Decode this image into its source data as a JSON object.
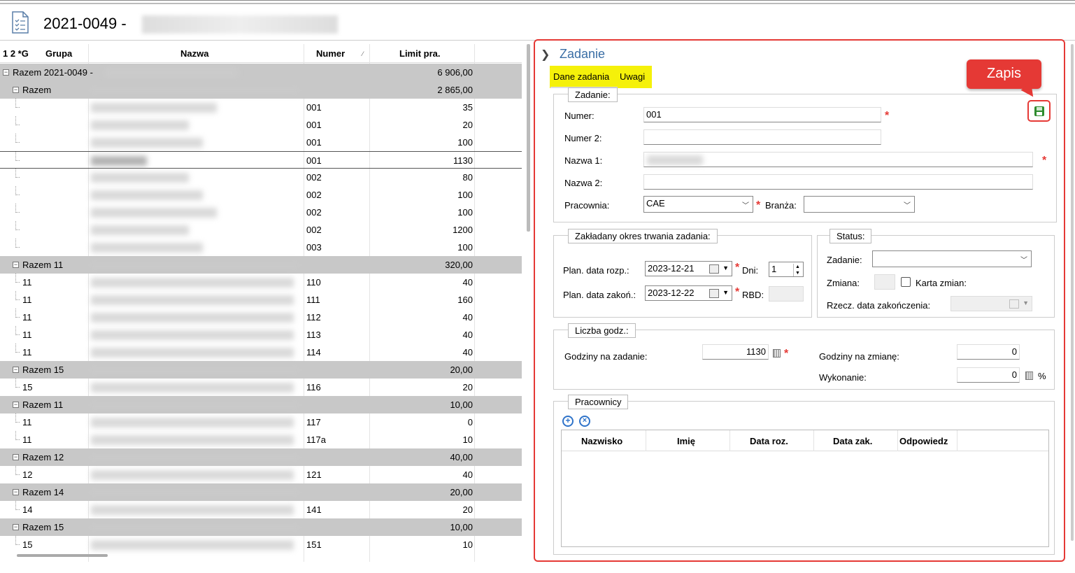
{
  "window": {
    "title": "2021-0049 -"
  },
  "grid": {
    "headers": {
      "levels": "1 2 *G",
      "grupa": "Grupa",
      "nazwa": "Nazwa",
      "numer": "Numer",
      "limit": "Limit pra."
    },
    "rows": [
      {
        "type": "group",
        "label": "Razem 2021-0049 -",
        "numer": "",
        "limit": "6 906,00"
      },
      {
        "type": "group",
        "label": "Razem",
        "numer": "",
        "limit": "2 865,00"
      },
      {
        "type": "item",
        "grupa": "",
        "numer": "001",
        "limit": "35"
      },
      {
        "type": "item",
        "grupa": "",
        "numer": "001",
        "limit": "20"
      },
      {
        "type": "item",
        "grupa": "",
        "numer": "001",
        "limit": "100"
      },
      {
        "type": "item",
        "grupa": "",
        "numer": "001",
        "limit": "1130",
        "selected": true
      },
      {
        "type": "item",
        "grupa": "",
        "numer": "002",
        "limit": "80"
      },
      {
        "type": "item",
        "grupa": "",
        "numer": "002",
        "limit": "100"
      },
      {
        "type": "item",
        "grupa": "",
        "numer": "002",
        "limit": "100"
      },
      {
        "type": "item",
        "grupa": "",
        "numer": "002",
        "limit": "1200"
      },
      {
        "type": "item",
        "grupa": "",
        "numer": "003",
        "limit": "100"
      },
      {
        "type": "group",
        "label": "Razem 11",
        "numer": "",
        "limit": "320,00"
      },
      {
        "type": "item",
        "grupa": "11",
        "numer": "110",
        "limit": "40"
      },
      {
        "type": "item",
        "grupa": "11",
        "numer": "111",
        "limit": "160"
      },
      {
        "type": "item",
        "grupa": "11",
        "numer": "112",
        "limit": "40"
      },
      {
        "type": "item",
        "grupa": "11",
        "numer": "113",
        "limit": "40"
      },
      {
        "type": "item",
        "grupa": "11",
        "numer": "114",
        "limit": "40"
      },
      {
        "type": "group",
        "label": "Razem 15",
        "numer": "",
        "limit": "20,00"
      },
      {
        "type": "item",
        "grupa": "15",
        "numer": "116",
        "limit": "20"
      },
      {
        "type": "group",
        "label": "Razem 11",
        "numer": "",
        "limit": "10,00"
      },
      {
        "type": "item",
        "grupa": "11",
        "numer": "117",
        "limit": "0"
      },
      {
        "type": "item",
        "grupa": "11",
        "numer": "117a",
        "limit": "10"
      },
      {
        "type": "group",
        "label": "Razem 12",
        "numer": "",
        "limit": "40,00"
      },
      {
        "type": "item",
        "grupa": "12",
        "numer": "121",
        "limit": "40"
      },
      {
        "type": "group",
        "label": "Razem 14",
        "numer": "",
        "limit": "20,00"
      },
      {
        "type": "item",
        "grupa": "14",
        "numer": "141",
        "limit": "20"
      },
      {
        "type": "group",
        "label": "Razem 15",
        "numer": "",
        "limit": "10,00"
      },
      {
        "type": "item",
        "grupa": "15",
        "numer": "151",
        "limit": "10"
      }
    ]
  },
  "panel": {
    "title": "Zadanie",
    "tabs": [
      "Dane zadania",
      "Uwagi"
    ],
    "callout": "Zapis",
    "zadanie_section": {
      "legend": "Zadanie:",
      "numer_label": "Numer:",
      "numer_value": "001",
      "numer2_label": "Numer 2:",
      "numer2_value": "",
      "nazwa1_label": "Nazwa 1:",
      "nazwa2_label": "Nazwa 2:",
      "nazwa2_value": "",
      "pracownia_label": "Pracownia:",
      "pracownia_value": "CAE",
      "branza_label": "Branża:",
      "branza_value": ""
    },
    "okres_section": {
      "legend": "Zakładany okres trwania zadania:",
      "plan_rozp_label": "Plan. data rozp.:",
      "plan_rozp_value": "2023-12-21",
      "dni_label": "Dni:",
      "dni_value": "1",
      "plan_zak_label": "Plan. data zakoń.:",
      "plan_zak_value": "2023-12-22",
      "rbd_label": "RBD:"
    },
    "status_section": {
      "legend": "Status:",
      "zadanie_label": "Zadanie:",
      "zmiana_label": "Zmiana:",
      "karta_label": "Karta zmian:",
      "rzecz_label": "Rzecz. data zakończenia:"
    },
    "godziny_section": {
      "legend": "Liczba godz.:",
      "na_zadanie_label": "Godziny na zadanie:",
      "na_zadanie_value": "1130",
      "na_zmiane_label": "Godziny na zmianę:",
      "na_zmiane_value": "0",
      "wykonanie_label": "Wykonanie:",
      "wykonanie_value": "0",
      "percent": "%"
    },
    "pracownicy_section": {
      "legend": "Pracownicy",
      "columns": [
        "Nazwisko",
        "Imię",
        "Data roz.",
        "Data zak.",
        "Odpowiedz"
      ]
    }
  },
  "colors": {
    "accent_red": "#e53935",
    "highlight_yellow": "#f5f10a",
    "title_blue": "#3a6ea5",
    "group_gray": "#c8c8c8",
    "save_green": "#2e8b2e"
  }
}
